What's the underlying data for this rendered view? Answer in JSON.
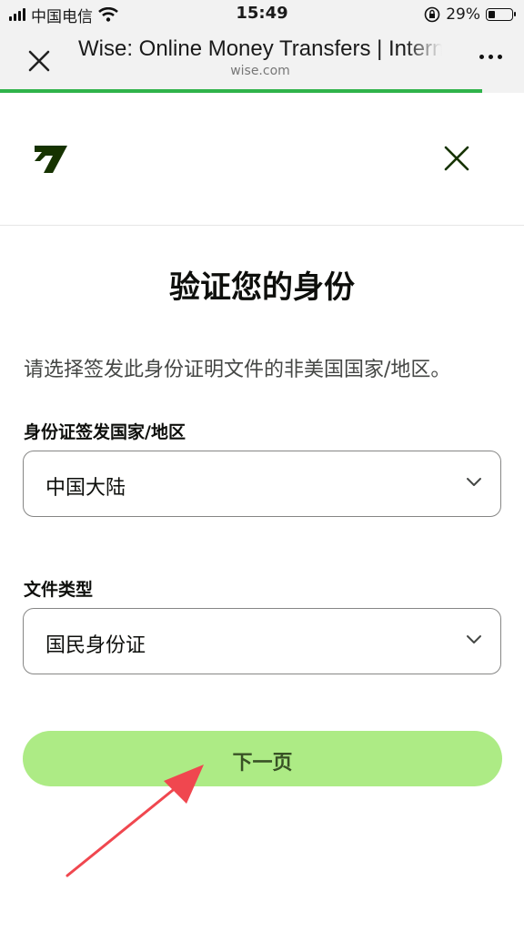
{
  "status_bar": {
    "carrier": "中国电信",
    "time": "15:49",
    "battery_percent": "29%",
    "battery_level": 0.29
  },
  "browser": {
    "title": "Wise: Online Money Transfers | International Banking",
    "domain": "wise.com",
    "load_progress": 0.92
  },
  "page": {
    "title": "验证您的身份",
    "subtitle": "请选择签发此身份证明文件的非美国国家/地区。",
    "country_field": {
      "label": "身份证签发国家/地区",
      "value": "中国大陆"
    },
    "doc_type_field": {
      "label": "文件类型",
      "value": "国民身份证"
    },
    "next_button": "下一页"
  },
  "colors": {
    "brand_green": "#9fe870",
    "brand_dark": "#163300",
    "progress": "#2fb34a",
    "annotation_arrow": "#f0474f"
  },
  "icons": [
    "signal-icon",
    "wifi-icon",
    "lock-rotation-icon",
    "battery-icon",
    "close-icon",
    "more-icon",
    "wise-logo",
    "chevron-down-icon"
  ]
}
